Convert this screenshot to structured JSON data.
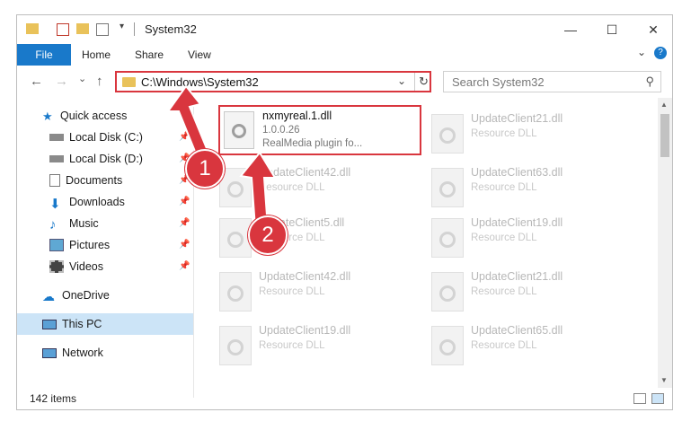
{
  "window": {
    "title": "System32",
    "controls": {
      "minimize": "—",
      "maximize": "☐",
      "close": "✕"
    }
  },
  "ribbon": {
    "file": "File",
    "tabs": [
      "Home",
      "Share",
      "View"
    ],
    "expand": "⌄",
    "help": "?"
  },
  "nav": {
    "back": "←",
    "forward": "→",
    "recent": "⌄",
    "up": "↑"
  },
  "address": {
    "path": "C:\\Windows\\System32",
    "dropdown": "⌄",
    "refresh": "↻"
  },
  "search": {
    "placeholder": "Search System32",
    "icon": "⚲"
  },
  "sidebar": {
    "quick_access": "Quick access",
    "items": [
      {
        "label": "Local Disk (C:)",
        "pinned": true
      },
      {
        "label": "Local Disk (D:)",
        "pinned": true
      },
      {
        "label": "Documents",
        "pinned": true
      },
      {
        "label": "Downloads",
        "pinned": true
      },
      {
        "label": "Music",
        "pinned": true
      },
      {
        "label": "Pictures",
        "pinned": true
      },
      {
        "label": "Videos",
        "pinned": true
      }
    ],
    "onedrive": "OneDrive",
    "this_pc": "This PC",
    "network": "Network",
    "pin_glyph": "📌"
  },
  "files": {
    "selected": {
      "name": "nxmyreal.1.dll",
      "version": "1.0.0.26",
      "description": "RealMedia plugin fo..."
    },
    "faded": [
      {
        "name": "UpdateClient21.dll",
        "desc": "Resource DLL"
      },
      {
        "name": "UpdateClient42.dll",
        "desc": "Resource DLL"
      },
      {
        "name": "UpdateClient63.dll",
        "desc": "Resource DLL"
      },
      {
        "name": "UpdateClient5.dll",
        "desc": "Resource DLL"
      },
      {
        "name": "UpdateClient19.dll",
        "desc": "Resource DLL"
      },
      {
        "name": "UpdateClient42.dll",
        "desc": "Resource DLL"
      },
      {
        "name": "UpdateClient21.dll",
        "desc": "Resource DLL"
      },
      {
        "name": "UpdateClient19.dll",
        "desc": "Resource DLL"
      },
      {
        "name": "UpdateClient65.dll",
        "desc": "Resource DLL"
      }
    ]
  },
  "status": {
    "count": "142 items"
  },
  "annotations": {
    "badge1": "1",
    "badge2": "2"
  },
  "colors": {
    "accent": "#1979ca",
    "highlight": "#d9363e"
  }
}
